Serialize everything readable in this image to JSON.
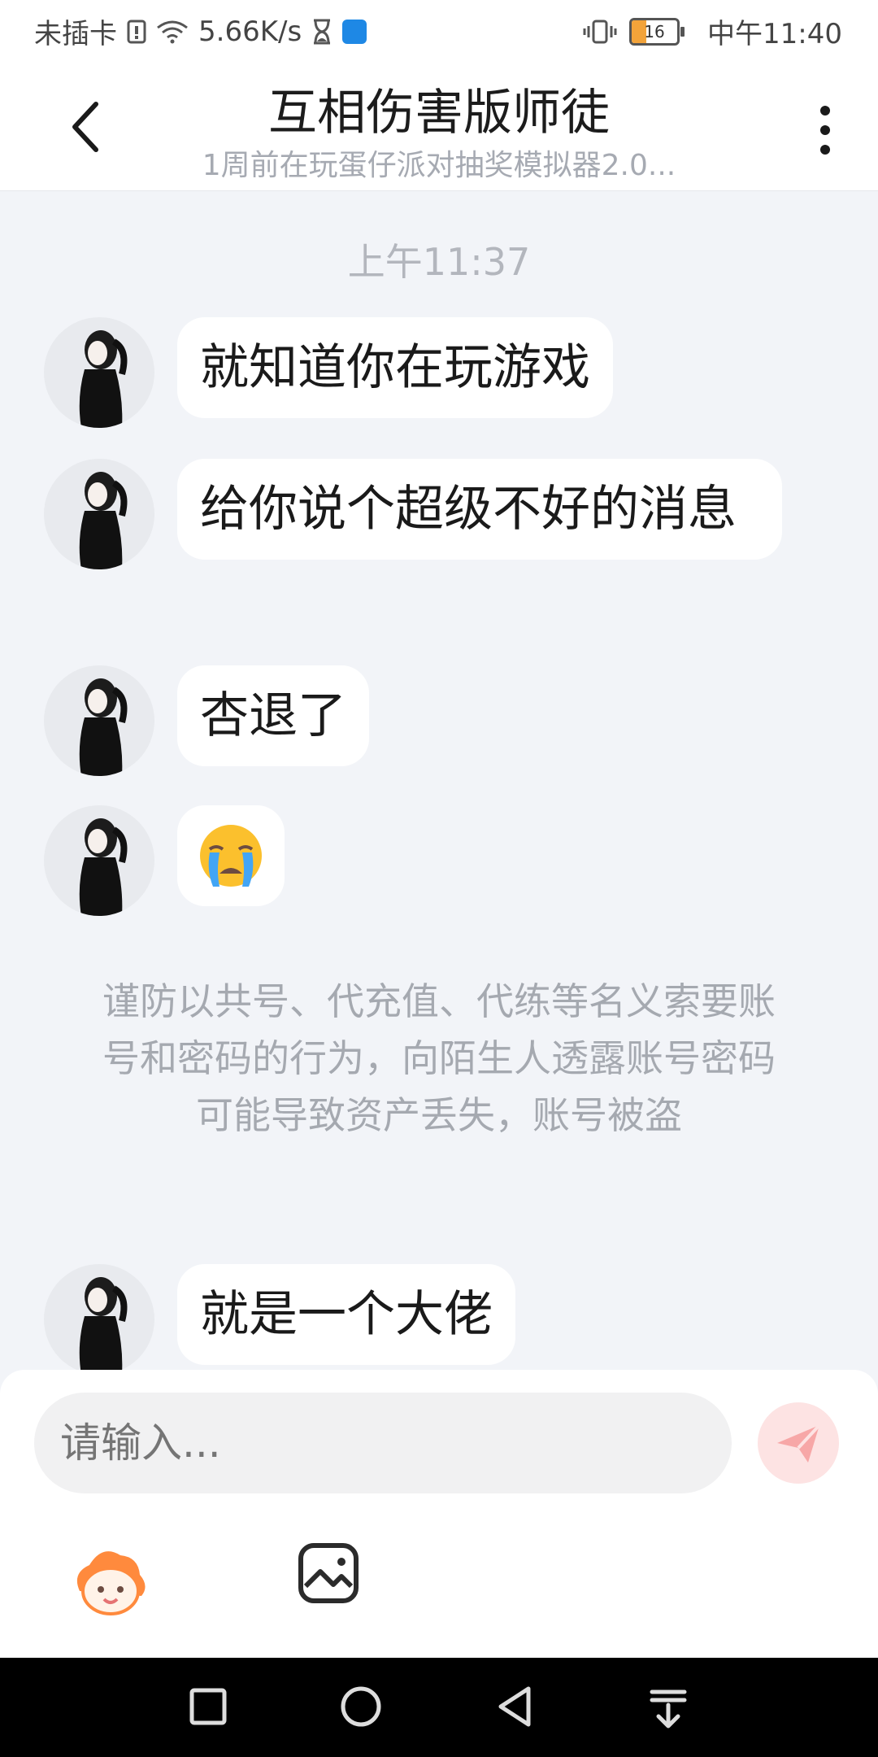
{
  "status_bar": {
    "carrier": "未插卡",
    "speed": "5.66K/s",
    "battery": "16",
    "time": "中午11:40"
  },
  "header": {
    "title": "互相伤害版师徒",
    "subtitle": "1周前在玩蛋仔派对抽奖模拟器2.0..."
  },
  "chat": {
    "timestamp": "上午11:37",
    "messages": [
      {
        "text": "就知道你在玩游戏"
      },
      {
        "text": "给你说个超级不好的消息"
      },
      {
        "text": "杏退了"
      },
      {
        "text": "😭"
      },
      {
        "text": "就是一个大佬"
      }
    ],
    "notice": "谨防以共号、代充值、代练等名义索要账号和密码的行为，向陌生人透露账号密码可能导致资产丢失，账号被盗"
  },
  "composer": {
    "placeholder": "请输入..."
  },
  "colors": {
    "background": "#f2f4f8",
    "send_button": "#fde3e3",
    "send_icon": "#f7a7a7"
  },
  "icons": [
    "back-icon",
    "more-icon",
    "send-icon",
    "emoji-icon",
    "image-icon",
    "square-icon",
    "circle-icon",
    "triangle-icon",
    "notification-pull-icon"
  ]
}
